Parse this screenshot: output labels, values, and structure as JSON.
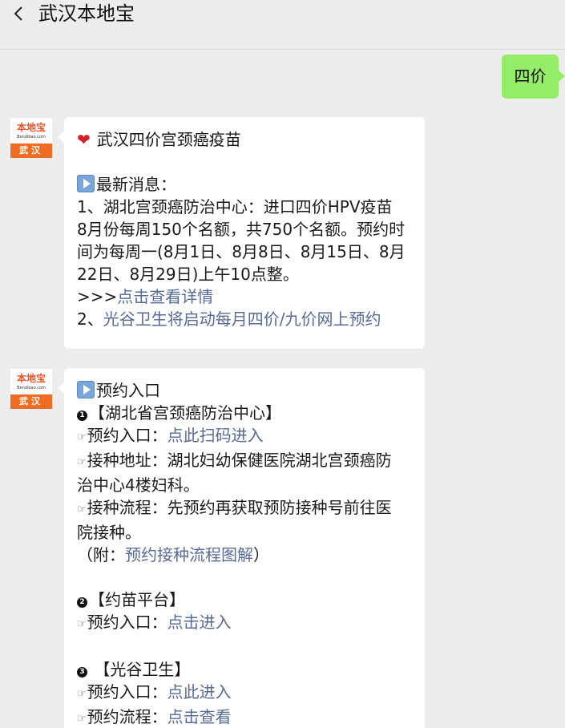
{
  "header": {
    "back_icon": "chevron-left-icon",
    "title": "武汉本地宝"
  },
  "outgoing": {
    "text": "四价"
  },
  "avatar": {
    "brand": "本地宝",
    "url": "Bendibao.com",
    "city": "武汉"
  },
  "msg1": {
    "heart_icon": "heart-icon",
    "title": "武汉四价宫颈癌疫苗",
    "section_label": "最新消息：",
    "item1_lines": [
      "1、湖北宫颈癌防治中心：进口四价HPV疫苗",
      "8月份每周150个名额，共750个名额。预约时",
      "间为每周一(8月1日、8月8日、8月15日、8月",
      "22日、8月29日)上午10点整。"
    ],
    "detail_prefix": ">>>",
    "detail_link": "点击查看详情",
    "item2_prefix": "2、",
    "item2_link": "光谷卫生将启动每月四价/九价网上预约"
  },
  "msg2": {
    "section_label": "预约入口",
    "center": {
      "num": "1",
      "name": "【湖北省宫颈癌防治中心】",
      "entry_label": "预约入口：",
      "entry_link": "点此扫码进入",
      "address_label": "接种地址：湖北妇幼保健医院湖北宫颈癌防",
      "address_cont": "治中心4楼妇科。",
      "process_label": "接种流程：先预约再获取预防接种号前往医",
      "process_cont": "院接种。",
      "note_prefix": "（附：",
      "note_link": "预约接种流程图解",
      "note_suffix": "）"
    },
    "platform": {
      "num": "2",
      "name": "【约苗平台】",
      "entry_label": "预约入口：",
      "entry_link": "点击进入"
    },
    "guanggu": {
      "num": "3",
      "name": " 【光谷卫生】",
      "entry_label": "预约入口：",
      "entry_link": "点此进入",
      "process_label": "预约流程：",
      "process_link": "点击查看"
    }
  },
  "colors": {
    "link": "#576b95",
    "outgoing_bubble": "#95ec69",
    "brand_orange": "#f06c22"
  }
}
